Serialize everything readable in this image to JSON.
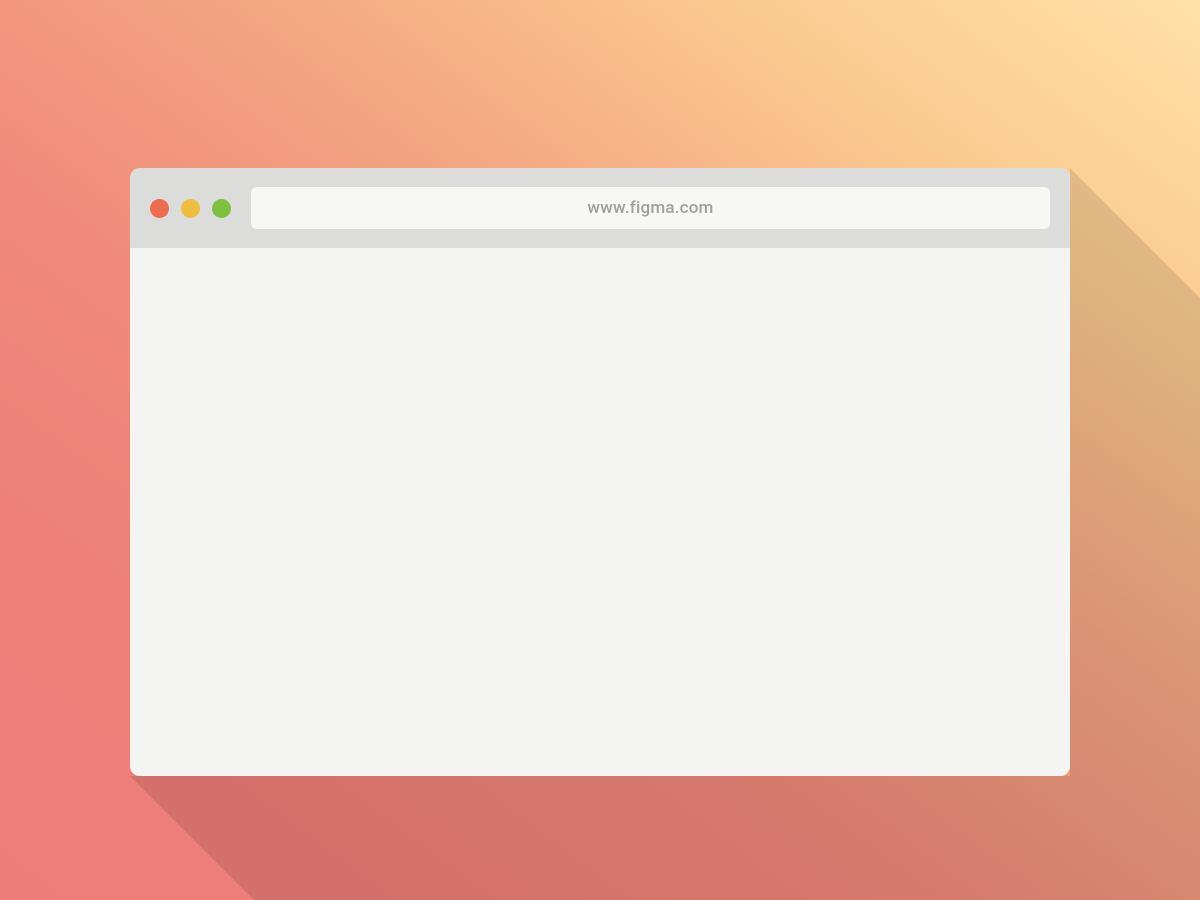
{
  "browser": {
    "address_bar": {
      "url_text": "www.figma.com"
    },
    "traffic_lights": {
      "close_color": "#ed6b51",
      "minimize_color": "#edbe42",
      "maximize_color": "#7cc140"
    }
  }
}
